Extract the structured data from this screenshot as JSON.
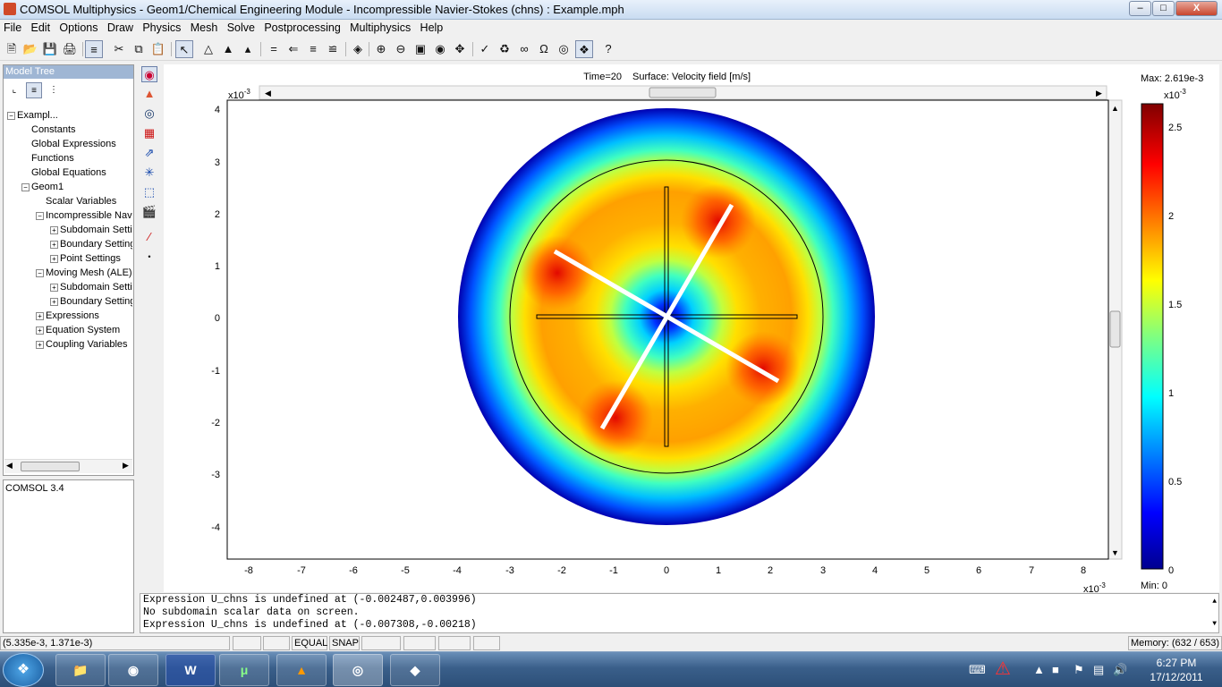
{
  "window": {
    "title": "COMSOL Multiphysics - Geom1/Chemical Engineering Module - Incompressible Navier-Stokes (chns) : Example.mph",
    "minimize": "–",
    "maximize": "□",
    "close": "X"
  },
  "menu": [
    "File",
    "Edit",
    "Options",
    "Draw",
    "Physics",
    "Mesh",
    "Solve",
    "Postprocessing",
    "Multiphysics",
    "Help"
  ],
  "model_tree": {
    "header": "Model Tree",
    "items": [
      {
        "label": "Exampl...",
        "exp": "−"
      },
      {
        "label": "Constants",
        "exp": ""
      },
      {
        "label": "Global Expressions",
        "exp": ""
      },
      {
        "label": "Functions",
        "exp": ""
      },
      {
        "label": "Global Equations",
        "exp": ""
      },
      {
        "label": "Geom1",
        "exp": "−"
      },
      {
        "label": "Scalar Variables",
        "exp": ""
      },
      {
        "label": "Incompressible Navi",
        "exp": "−"
      },
      {
        "label": "Subdomain Settir",
        "exp": "+"
      },
      {
        "label": "Boundary Setting",
        "exp": "+"
      },
      {
        "label": "Point Settings",
        "exp": "+"
      },
      {
        "label": "Moving Mesh (ALE) (",
        "exp": "−"
      },
      {
        "label": "Subdomain Settir",
        "exp": "+"
      },
      {
        "label": "Boundary Setting",
        "exp": "+"
      },
      {
        "label": "Expressions",
        "exp": "+"
      },
      {
        "label": "Equation System",
        "exp": "+"
      },
      {
        "label": "Coupling Variables",
        "exp": "+"
      }
    ]
  },
  "info_panel": "COMSOL 3.4",
  "plot": {
    "header_time": "Time=20",
    "header_surface": "Surface: Velocity field [m/s]",
    "x_exponent": "x10",
    "x_exponent_power": "-3",
    "y_exponent": "x10",
    "y_exponent_power": "-3",
    "x_ticks": [
      "-8",
      "-7",
      "-6",
      "-5",
      "-4",
      "-3",
      "-2",
      "-1",
      "0",
      "1",
      "2",
      "3",
      "4",
      "5",
      "6",
      "7",
      "8"
    ],
    "y_ticks": [
      "4",
      "3",
      "2",
      "1",
      "0",
      "-1",
      "-2",
      "-3",
      "-4"
    ]
  },
  "colorbar": {
    "max_label": "Max: 2.619e-3",
    "min_label": "Min: 0",
    "exponent": "x10",
    "exponent_power": "-3",
    "ticks": [
      "2.5",
      "2",
      "1.5",
      "1",
      "0.5",
      "0"
    ]
  },
  "console": [
    "Expression U_chns is undefined at (-0.002487,0.003996)",
    "No subdomain scalar data on screen.",
    "Expression U_chns is undefined at (-0.007308,-0.00218)"
  ],
  "status": {
    "coords": "(5.335e-3, 1.371e-3)",
    "equal": "EQUAL",
    "snap": "SNAP",
    "memory": "Memory: (632 / 653)"
  },
  "taskbar": {
    "time": "6:27 PM",
    "date": "17/12/2011"
  }
}
